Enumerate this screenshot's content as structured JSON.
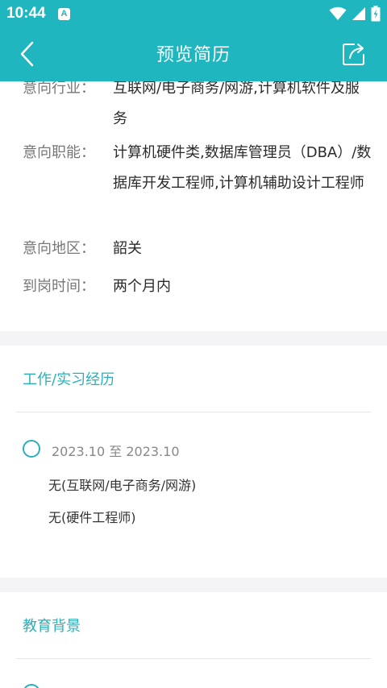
{
  "status_bar": {
    "time": "10:44",
    "notification_badge": "A",
    "icons": [
      "wifi-icon",
      "signal-icon",
      "battery-icon"
    ]
  },
  "nav": {
    "title": "预览简历",
    "back_icon": "chevron-left-icon",
    "share_icon": "share-icon"
  },
  "intent": {
    "rows": [
      {
        "label": "意向行业：",
        "value": "互联网/电子商务/网游,计算机软件及服务"
      },
      {
        "label": "意向职能：",
        "value": "计算机硬件类,数据库管理员（DBA）/数据库开发工程师,计算机辅助设计工程师"
      },
      {
        "label": "意向地区：",
        "value": "韶关"
      },
      {
        "label": "到岗时间：",
        "value": "两个月内"
      }
    ]
  },
  "work": {
    "section_title": "工作/实习经历",
    "items": [
      {
        "date": "2023.10  至  2023.10",
        "company": "无(互联网/电子商务/网游)",
        "position": "无(硬件工程师)"
      }
    ]
  },
  "education": {
    "section_title": "教育背景"
  },
  "colors": {
    "brand": "#1fb6bf",
    "accent_text": "#2ab0bb",
    "background": "#f4f4f6"
  }
}
